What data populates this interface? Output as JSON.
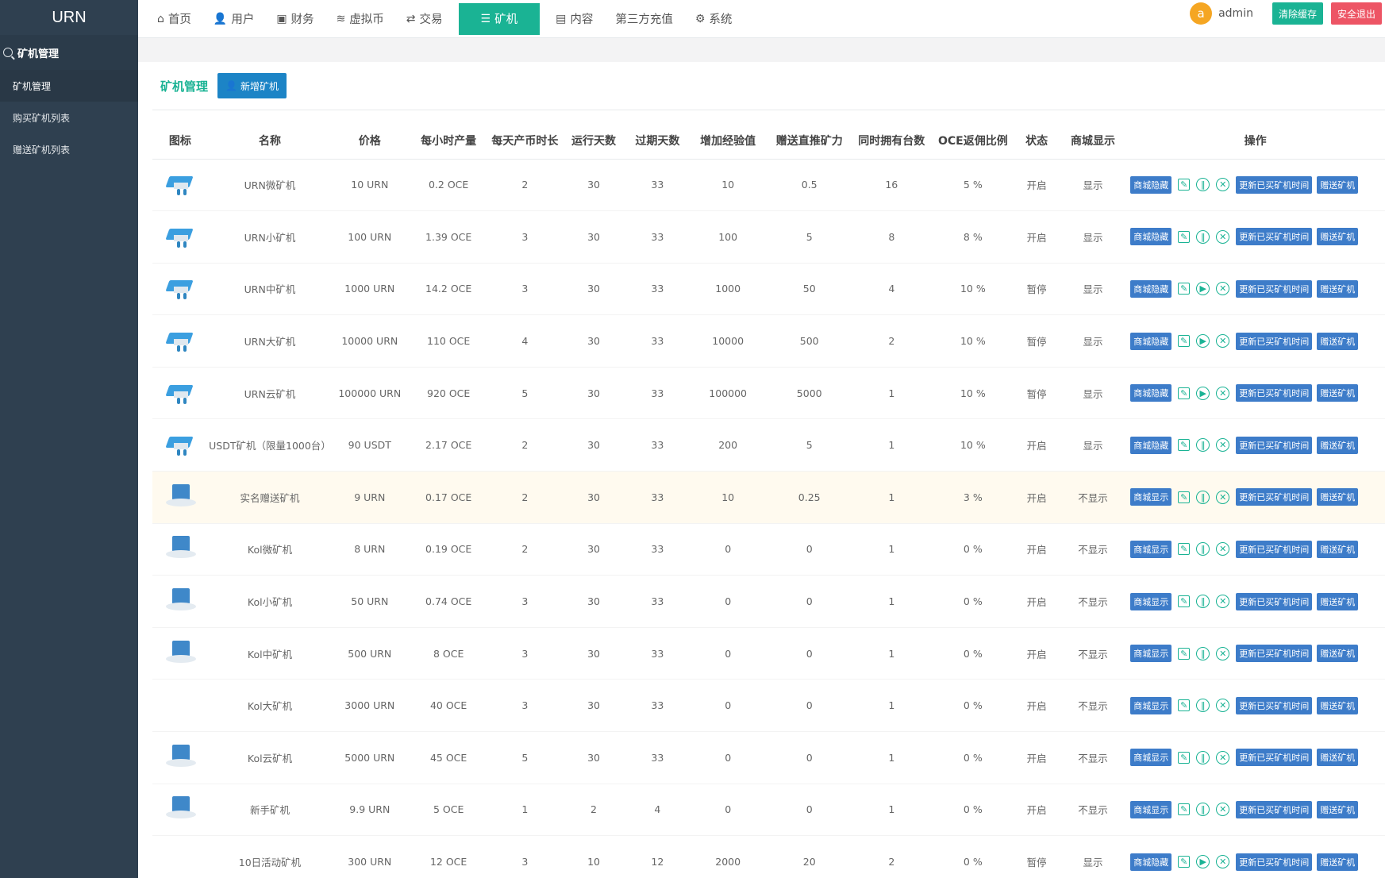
{
  "sidebar": {
    "brand": "URN",
    "section": "矿机管理",
    "items": [
      {
        "label": "矿机管理",
        "active": true
      },
      {
        "label": "购买矿机列表",
        "active": false
      },
      {
        "label": "赠送矿机列表",
        "active": false
      }
    ]
  },
  "topnav": {
    "items": [
      {
        "label": "首页",
        "icon": "home-icon",
        "glyph": "⌂"
      },
      {
        "label": "用户",
        "icon": "user-icon",
        "glyph": "👤"
      },
      {
        "label": "财务",
        "icon": "finance-icon",
        "glyph": "▣"
      },
      {
        "label": "虚拟币",
        "icon": "database-icon",
        "glyph": "≋"
      },
      {
        "label": "交易",
        "icon": "exchange-icon",
        "glyph": "⇄"
      },
      {
        "label": "矿机",
        "icon": "list-icon",
        "glyph": "☰",
        "active": true
      },
      {
        "label": "内容",
        "icon": "document-icon",
        "glyph": "▤"
      },
      {
        "label": "第三方充值",
        "icon": "",
        "glyph": ""
      },
      {
        "label": "系统",
        "icon": "gear-icon",
        "glyph": "⚙"
      }
    ],
    "avatar_letter": "a",
    "username": "admin",
    "clear_cache": "清除缓存",
    "logout": "安全退出"
  },
  "page": {
    "title": "矿机管理",
    "add_button": "新增矿机"
  },
  "table": {
    "headers": [
      "图标",
      "名称",
      "价格",
      "每小时产量",
      "每天产币时长",
      "运行天数",
      "过期天数",
      "增加经验值",
      "赠送直推矿力",
      "同时拥有台数",
      "OCE返佣比例",
      "状态",
      "商城显示",
      "操作"
    ],
    "actions": {
      "edit_icon": "edit-icon",
      "pause_icon": "pause-icon",
      "play_icon": "play-icon",
      "delete_icon": "close-circle-icon",
      "update_time": "更新已买矿机时间",
      "gift": "赠送矿机"
    },
    "rows": [
      {
        "thumb": "drone",
        "name": "URN微矿机",
        "price": "10 URN",
        "hourly": "0.2 OCE",
        "daily_hours": "2",
        "run_days": "30",
        "expire_days": "33",
        "exp": "10",
        "gift_power": "0.5",
        "max_own": "16",
        "ratio": "5 %",
        "status": "开启",
        "shop": "显示",
        "shop_btn": "商城隐藏",
        "paused": false
      },
      {
        "thumb": "drone",
        "name": "URN小矿机",
        "price": "100 URN",
        "hourly": "1.39 OCE",
        "daily_hours": "3",
        "run_days": "30",
        "expire_days": "33",
        "exp": "100",
        "gift_power": "5",
        "max_own": "8",
        "ratio": "8 %",
        "status": "开启",
        "shop": "显示",
        "shop_btn": "商城隐藏",
        "paused": false
      },
      {
        "thumb": "drone",
        "name": "URN中矿机",
        "price": "1000 URN",
        "hourly": "14.2 OCE",
        "daily_hours": "3",
        "run_days": "30",
        "expire_days": "33",
        "exp": "1000",
        "gift_power": "50",
        "max_own": "4",
        "ratio": "10 %",
        "status": "暂停",
        "shop": "显示",
        "shop_btn": "商城隐藏",
        "paused": true
      },
      {
        "thumb": "drone",
        "name": "URN大矿机",
        "price": "10000 URN",
        "hourly": "110 OCE",
        "daily_hours": "4",
        "run_days": "30",
        "expire_days": "33",
        "exp": "10000",
        "gift_power": "500",
        "max_own": "2",
        "ratio": "10 %",
        "status": "暂停",
        "shop": "显示",
        "shop_btn": "商城隐藏",
        "paused": true
      },
      {
        "thumb": "drone",
        "name": "URN云矿机",
        "price": "100000 URN",
        "hourly": "920 OCE",
        "daily_hours": "5",
        "run_days": "30",
        "expire_days": "33",
        "exp": "100000",
        "gift_power": "5000",
        "max_own": "1",
        "ratio": "10 %",
        "status": "暂停",
        "shop": "显示",
        "shop_btn": "商城隐藏",
        "paused": true
      },
      {
        "thumb": "drone",
        "name": "USDT矿机（限量1000台）",
        "price": "90 USDT",
        "hourly": "2.17 OCE",
        "daily_hours": "2",
        "run_days": "30",
        "expire_days": "33",
        "exp": "200",
        "gift_power": "5",
        "max_own": "1",
        "ratio": "10 %",
        "status": "开启",
        "shop": "显示",
        "shop_btn": "商城隐藏",
        "paused": false
      },
      {
        "thumb": "box",
        "name": "实名赠送矿机",
        "price": "9 URN",
        "hourly": "0.17 OCE",
        "daily_hours": "2",
        "run_days": "30",
        "expire_days": "33",
        "exp": "10",
        "gift_power": "0.25",
        "max_own": "1",
        "ratio": "3 %",
        "status": "开启",
        "shop": "不显示",
        "shop_btn": "商城显示",
        "paused": false,
        "highlight": true
      },
      {
        "thumb": "box",
        "name": "Kol微矿机",
        "price": "8 URN",
        "hourly": "0.19 OCE",
        "daily_hours": "2",
        "run_days": "30",
        "expire_days": "33",
        "exp": "0",
        "gift_power": "0",
        "max_own": "1",
        "ratio": "0 %",
        "status": "开启",
        "shop": "不显示",
        "shop_btn": "商城显示",
        "paused": false
      },
      {
        "thumb": "box",
        "name": "Kol小矿机",
        "price": "50 URN",
        "hourly": "0.74 OCE",
        "daily_hours": "3",
        "run_days": "30",
        "expire_days": "33",
        "exp": "0",
        "gift_power": "0",
        "max_own": "1",
        "ratio": "0 %",
        "status": "开启",
        "shop": "不显示",
        "shop_btn": "商城显示",
        "paused": false
      },
      {
        "thumb": "box",
        "name": "Kol中矿机",
        "price": "500 URN",
        "hourly": "8 OCE",
        "daily_hours": "3",
        "run_days": "30",
        "expire_days": "33",
        "exp": "0",
        "gift_power": "0",
        "max_own": "1",
        "ratio": "0 %",
        "status": "开启",
        "shop": "不显示",
        "shop_btn": "商城显示",
        "paused": false
      },
      {
        "thumb": "none",
        "name": "Kol大矿机",
        "price": "3000 URN",
        "hourly": "40 OCE",
        "daily_hours": "3",
        "run_days": "30",
        "expire_days": "33",
        "exp": "0",
        "gift_power": "0",
        "max_own": "1",
        "ratio": "0 %",
        "status": "开启",
        "shop": "不显示",
        "shop_btn": "商城显示",
        "paused": false
      },
      {
        "thumb": "box",
        "name": "Kol云矿机",
        "price": "5000 URN",
        "hourly": "45 OCE",
        "daily_hours": "5",
        "run_days": "30",
        "expire_days": "33",
        "exp": "0",
        "gift_power": "0",
        "max_own": "1",
        "ratio": "0 %",
        "status": "开启",
        "shop": "不显示",
        "shop_btn": "商城显示",
        "paused": false
      },
      {
        "thumb": "box",
        "name": "新手矿机",
        "price": "9.9 URN",
        "hourly": "5 OCE",
        "daily_hours": "1",
        "run_days": "2",
        "expire_days": "4",
        "exp": "0",
        "gift_power": "0",
        "max_own": "1",
        "ratio": "0 %",
        "status": "开启",
        "shop": "不显示",
        "shop_btn": "商城显示",
        "paused": false
      },
      {
        "thumb": "none",
        "name": "10日活动矿机",
        "price": "300 URN",
        "hourly": "12 OCE",
        "daily_hours": "3",
        "run_days": "10",
        "expire_days": "12",
        "exp": "2000",
        "gift_power": "20",
        "max_own": "2",
        "ratio": "0 %",
        "status": "暂停",
        "shop": "显示",
        "shop_btn": "商城隐藏",
        "paused": true
      }
    ]
  },
  "colors": {
    "sidebar_bg": "#2f4050",
    "accent_green": "#1ab394",
    "button_blue": "#3d7cc9",
    "logout_red": "#ed5565",
    "avatar_orange": "#f5a623"
  }
}
